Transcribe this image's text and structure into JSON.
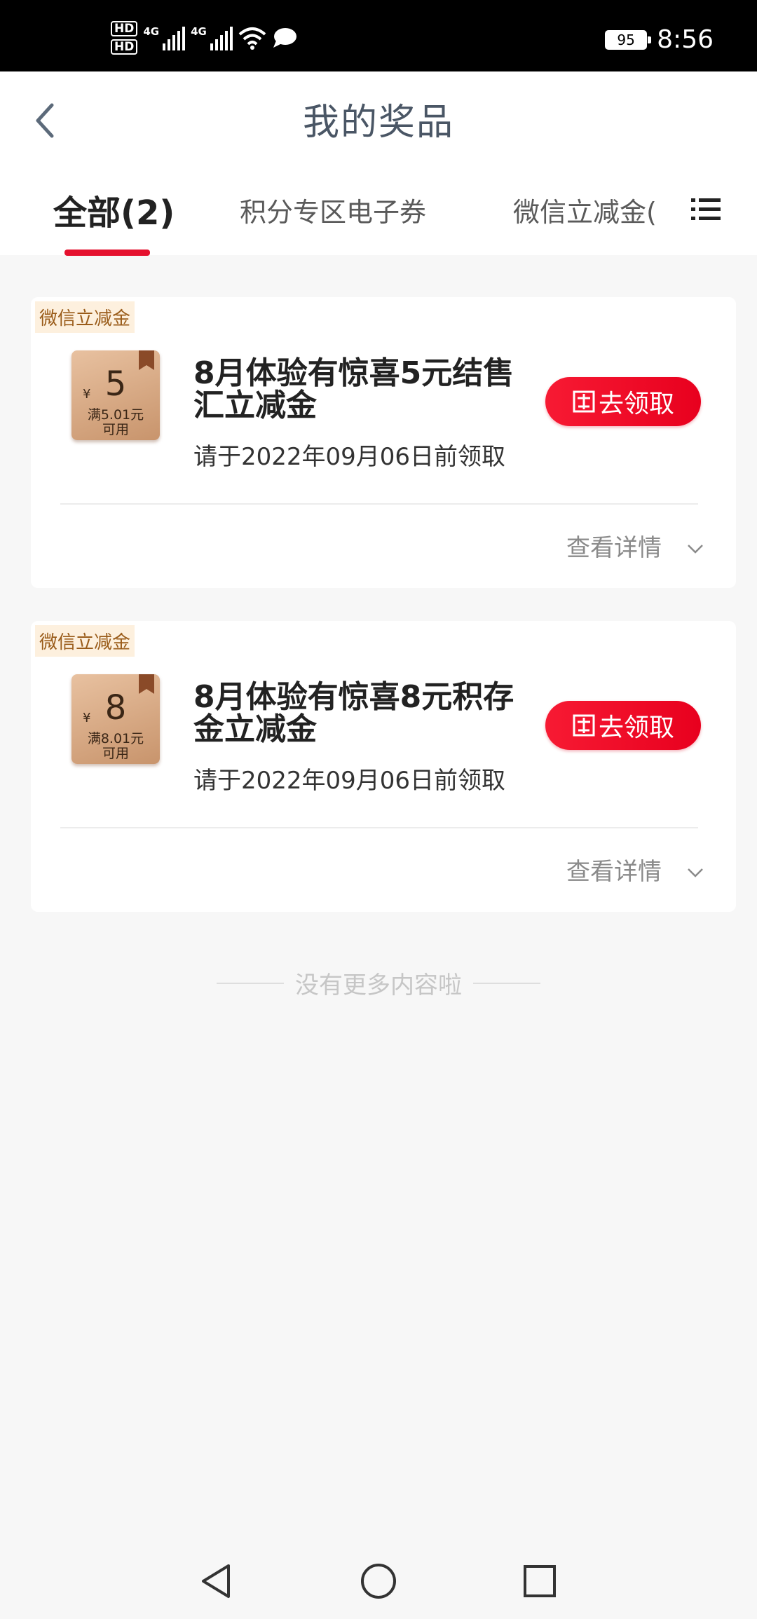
{
  "status_bar": {
    "hd1": "HD",
    "hd2": "HD",
    "net1": "4G",
    "net2": "4G",
    "battery": "95",
    "time": "8:56"
  },
  "header": {
    "title": "我的奖品"
  },
  "tabs": [
    {
      "label": "全部(2)",
      "active": true
    },
    {
      "label": "积分专区电子券",
      "active": false
    },
    {
      "label": "微信立减金(",
      "active": false
    }
  ],
  "cards": [
    {
      "tag": "微信立减金",
      "coupon": {
        "currency": "¥",
        "amount": "5",
        "condition_line1": "满5.01元",
        "condition_line2": "可用"
      },
      "title": "8月体验有惊喜5元结售汇立减金",
      "deadline": "请于2022年09月06日前领取",
      "claim_label": "去领取",
      "detail_label": "查看详情"
    },
    {
      "tag": "微信立减金",
      "coupon": {
        "currency": "¥",
        "amount": "8",
        "condition_line1": "满8.01元",
        "condition_line2": "可用"
      },
      "title": "8月体验有惊喜8元积存金立减金",
      "deadline": "请于2022年09月06日前领取",
      "claim_label": "去领取",
      "detail_label": "查看详情"
    }
  ],
  "end_text": "没有更多内容啦",
  "colors": {
    "accent": "#e5112e",
    "button": "#f71a33",
    "tag_bg": "#fdf0de",
    "tag_text": "#9a5c1a"
  },
  "icons": [
    "back-icon",
    "menu-list-icon",
    "claim-icon",
    "chevron-down-icon",
    "nav-back-icon",
    "nav-home-icon",
    "nav-recents-icon"
  ]
}
